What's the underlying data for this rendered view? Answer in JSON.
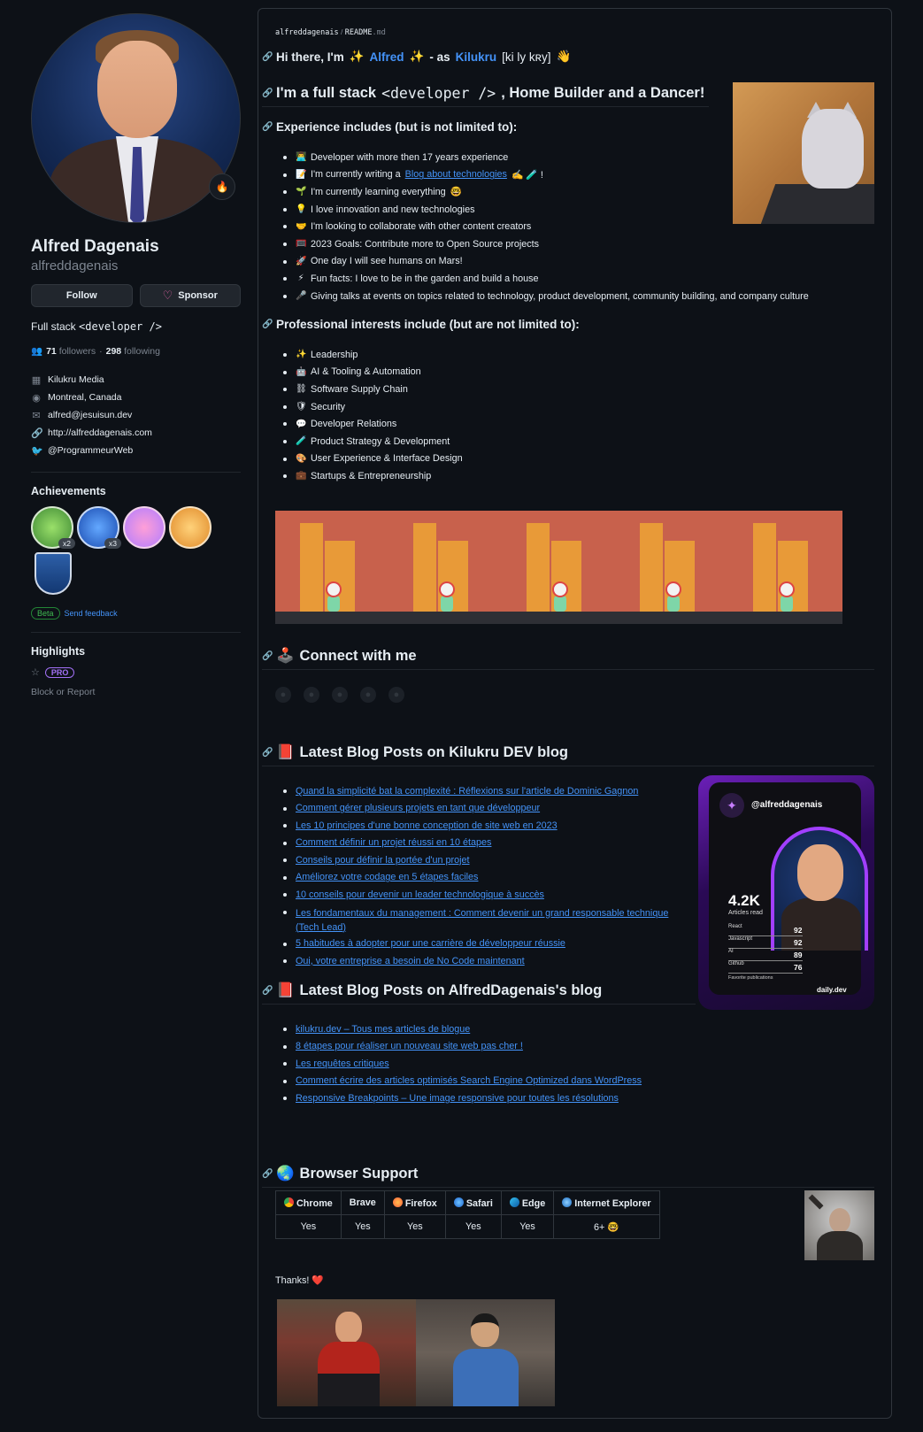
{
  "profile": {
    "name": "Alfred Dagenais",
    "username": "alfreddagenais",
    "follow_label": "Follow",
    "sponsor_label": "Sponsor",
    "bio_prefix": "Full stack ",
    "bio_code": "<developer />",
    "followers_count": "71",
    "followers_label": "followers",
    "separator": "·",
    "following_count": "298",
    "following_label": "following",
    "company": "Kilukru Media",
    "location": "Montreal, Canada",
    "email": "alfred@jesuisun.dev",
    "website": "http://alfreddagenais.com",
    "twitter": "@ProgrammeurWeb",
    "achievements_title": "Achievements",
    "achievement_counts": [
      "x2",
      "x3"
    ],
    "beta_label": "Beta",
    "feedback_label": "Send feedback",
    "highlights_title": "Highlights",
    "pro_label": "PRO",
    "block_label": "Block or Report"
  },
  "readme": {
    "breadcrumb_user": "alfreddagenais",
    "breadcrumb_sep": "/",
    "breadcrumb_file": "README",
    "breadcrumb_ext": ".md",
    "greeting_pre": "Hi there, I'm",
    "greeting_name": "Alfred",
    "greeting_mid": "- as",
    "greeting_alias": "Kilukru",
    "greeting_phonetic": "[ki ly kʀy]",
    "title_pre": "I'm a full stack",
    "title_code": "<developer />",
    "title_post": ", Home Builder and a Dancer!",
    "experience_title": "Experience includes (but is not limited to):",
    "experience": [
      {
        "emoji": "👨‍💻",
        "pre": "Developer with more then 17 years experience",
        "link": "",
        "post": ""
      },
      {
        "emoji": "📝",
        "pre": "I'm currently writing a",
        "link": "Blog about technologies",
        "post": "✍️ 🧪 !"
      },
      {
        "emoji": "🌱",
        "pre": "I'm currently learning everything",
        "link": "",
        "post": "🤓"
      },
      {
        "emoji": "💡",
        "pre": "I love innovation and new technologies",
        "link": "",
        "post": ""
      },
      {
        "emoji": "🤝",
        "pre": "I'm looking to collaborate with other content creators",
        "link": "",
        "post": ""
      },
      {
        "emoji": "🥅",
        "pre": "2023 Goals: Contribute more to Open Source projects",
        "link": "",
        "post": ""
      },
      {
        "emoji": "🚀",
        "pre": "One day I will see humans on Mars!",
        "link": "",
        "post": ""
      },
      {
        "emoji": "⚡",
        "pre": "Fun facts: I love to be in the garden and build a house",
        "link": "",
        "post": ""
      },
      {
        "emoji": "🎤",
        "pre": "Giving talks at events on topics related to technology, product development, community building, and company culture",
        "link": "",
        "post": ""
      }
    ],
    "interests_title": "Professional interests include (but are not limited to):",
    "interests": [
      {
        "emoji": "✨",
        "text": "Leadership"
      },
      {
        "emoji": "🤖",
        "text": "AI & Tooling & Automation"
      },
      {
        "emoji": "⛓",
        "text": "Software Supply Chain"
      },
      {
        "emoji": "🛡",
        "text": "Security"
      },
      {
        "emoji": "💬",
        "text": "Developer Relations"
      },
      {
        "emoji": "🧪",
        "text": "Product Strategy & Development"
      },
      {
        "emoji": "🎨",
        "text": "User Experience & Interface Design"
      },
      {
        "emoji": "💼",
        "text": "Startups & Entrepreneurship"
      }
    ],
    "connect_emoji": "🕹️",
    "connect_title": "Connect with me",
    "blog1_emoji": "📕",
    "blog1_title": "Latest Blog Posts on Kilukru DEV blog",
    "blog1_posts": [
      "Quand la simplicité bat la complexité : Réflexions sur l'article de Dominic Gagnon",
      "Comment gérer plusieurs projets en tant que développeur",
      "Les 10 principes d'une bonne conception de site web en 2023",
      "Comment définir un projet réussi en 10 étapes",
      "Conseils pour définir la portée d'un projet",
      "Améliorez votre codage en 5 étapes faciles",
      "10 conseils pour devenir un leader technologique à succès",
      "Les fondamentaux du management : Comment devenir un grand responsable technique",
      "5 habitudes à adopter pour une carrière de développeur réussie",
      "Oui, votre entreprise a besoin de No Code maintenant"
    ],
    "blog1_post_wrap": "(Tech Lead)",
    "blog2_emoji": "📕",
    "blog2_title": "Latest Blog Posts on AlfredDagenais's blog",
    "blog2_posts": [
      "kilukru.dev – Tous mes articles de blogue",
      "8 étapes pour réaliser un nouveau site web pas cher !",
      "Les requêtes critiques",
      "Comment écrire des articles optimisés Search Engine Optimized dans WordPress",
      "Responsive Breakpoints – Une image responsive pour toutes les résolutions"
    ],
    "browser_emoji": "🌏",
    "browser_title": "Browser Support",
    "browsers": [
      {
        "name": "Chrome",
        "support": "Yes",
        "color": "#e84335"
      },
      {
        "name": "Brave",
        "support": "Yes",
        "color": ""
      },
      {
        "name": "Firefox",
        "support": "Yes",
        "color": "#ff7139"
      },
      {
        "name": "Safari",
        "support": "Yes",
        "color": "#1e88e5"
      },
      {
        "name": "Edge",
        "support": "Yes",
        "color": "#1ba1e2"
      },
      {
        "name": "Internet Explorer",
        "support": "6+ 🤓",
        "color": "#3d8fd6"
      }
    ],
    "thanks": "Thanks!",
    "thanks_emoji": "❤️"
  },
  "daily_dev": {
    "handle": "@alfreddagenais",
    "articles": "4.2K",
    "articles_label": "Articles read",
    "stats": [
      {
        "label": "React",
        "value": "92"
      },
      {
        "label": "Javascript",
        "value": "92"
      },
      {
        "label": "AI",
        "value": "89"
      },
      {
        "label": "Github",
        "value": "76"
      }
    ],
    "favorites_label": "Favorite publications",
    "brand": "daily.dev"
  },
  "colors": {
    "background": "#0d1117",
    "link": "#4493f8",
    "muted": "#7d8590",
    "border": "#30363d"
  }
}
